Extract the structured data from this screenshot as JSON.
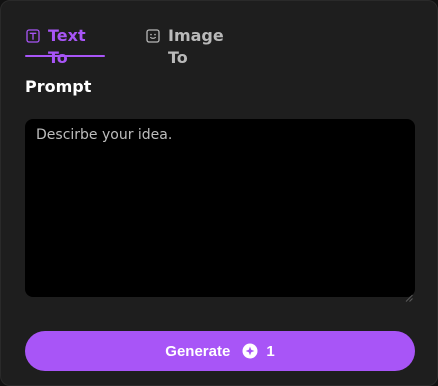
{
  "tabs": [
    {
      "label": "Text To",
      "icon": "text-icon",
      "active": true
    },
    {
      "label": "Image To",
      "icon": "image-face-icon",
      "active": false
    }
  ],
  "prompt": {
    "label": "Prompt",
    "placeholder": "Descirbe your idea.",
    "value": ""
  },
  "generate": {
    "label": "Generate",
    "credit_icon": "credit-icon",
    "credits": "1"
  },
  "colors": {
    "accent": "#a855f7",
    "panel": "#1e1e1e",
    "input_bg": "#000000"
  }
}
